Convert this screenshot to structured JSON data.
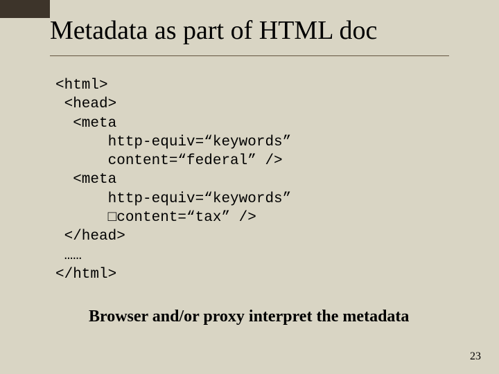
{
  "title": "Metadata as part of HTML doc",
  "code_lines": [
    "<html>",
    " <head>",
    "  <meta",
    "      http-equiv=“keywords”",
    "      content=“federal” />",
    "  <meta",
    "      http-equiv=“keywords”",
    "      □content=“tax” />",
    " </head>",
    " ……",
    "</html>"
  ],
  "caption": "Browser and/or proxy interpret the metadata",
  "page_number": "23"
}
